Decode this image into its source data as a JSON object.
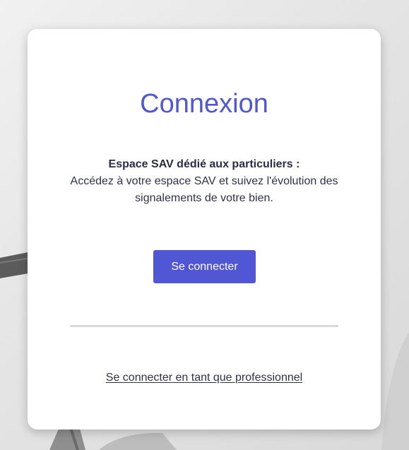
{
  "login": {
    "title": "Connexion",
    "intro_heading": "Espace SAV dédié aux particuliers :",
    "intro_text": "Accédez à votre espace SAV et suivez l'évolution des signalements de votre bien.",
    "connect_button_label": "Se connecter",
    "pro_link_label": "Se connecter en tant que professionnel"
  },
  "colors": {
    "accent": "#5157d4",
    "text": "#2f3248",
    "divider": "#d7d8e0",
    "card_background": "#ffffff"
  }
}
